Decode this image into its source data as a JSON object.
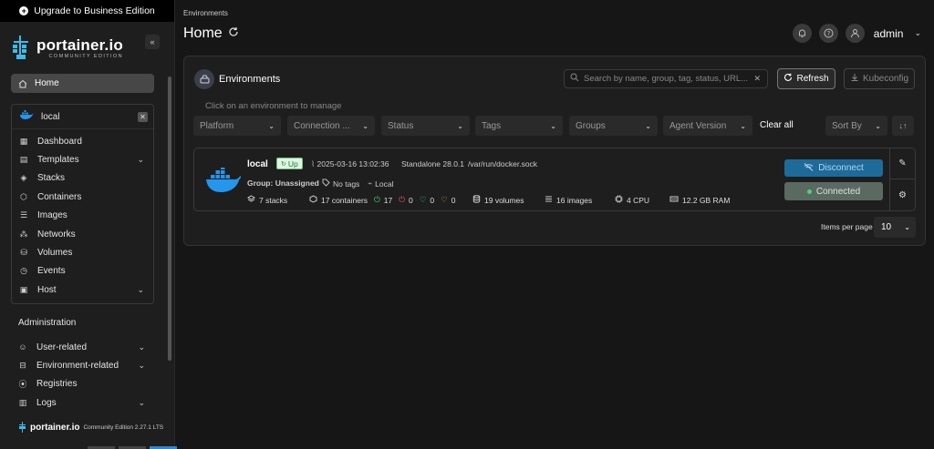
{
  "sidebar": {
    "upgrade_label": "Upgrade to Business Edition",
    "logo_title": "portainer.io",
    "logo_subtitle": "COMMUNITY EDITION",
    "home_label": "Home",
    "environment": {
      "name": "local",
      "items": [
        {
          "label": "Dashboard",
          "icon": "dashboard-icon",
          "chevron": false
        },
        {
          "label": "Templates",
          "icon": "templates-icon",
          "chevron": true
        },
        {
          "label": "Stacks",
          "icon": "stacks-icon",
          "chevron": false
        },
        {
          "label": "Containers",
          "icon": "containers-icon",
          "chevron": false
        },
        {
          "label": "Images",
          "icon": "images-icon",
          "chevron": false
        },
        {
          "label": "Networks",
          "icon": "networks-icon",
          "chevron": false
        },
        {
          "label": "Volumes",
          "icon": "volumes-icon",
          "chevron": false
        },
        {
          "label": "Events",
          "icon": "events-icon",
          "chevron": false
        },
        {
          "label": "Host",
          "icon": "host-icon",
          "chevron": true
        }
      ]
    },
    "admin_heading": "Administration",
    "admin_items": [
      {
        "label": "User-related",
        "icon": "users-icon",
        "chevron": true
      },
      {
        "label": "Environment-related",
        "icon": "environment-icon",
        "chevron": true
      },
      {
        "label": "Registries",
        "icon": "registries-icon",
        "chevron": false
      },
      {
        "label": "Logs",
        "icon": "logs-icon",
        "chevron": true
      }
    ],
    "footer_brand": "portainer.io",
    "footer_edition": "Community Edition 2.27.1 LTS"
  },
  "header": {
    "breadcrumb": "Environments",
    "title": "Home",
    "user": "admin"
  },
  "panel": {
    "title": "Environments",
    "search_placeholder": "Search by name, group, tag, status, URL...",
    "refresh_label": "Refresh",
    "kubeconfig_label": "Kubeconfig",
    "hint": "Click on an environment to manage",
    "filters": {
      "platform": "Platform",
      "connection": "Connection ...",
      "status": "Status",
      "tags": "Tags",
      "groups": "Groups",
      "agent_version": "Agent Version",
      "clear_all": "Clear all",
      "sort_by": "Sort By"
    },
    "environment": {
      "name": "local",
      "status": "Up",
      "timestamp": "2025-03-16 13:02:36",
      "type": "Standalone 28.0.1",
      "socket": "/var/run/docker.sock",
      "group": "Group: Unassigned",
      "tags": "No tags",
      "location": "Local",
      "stacks": "7 stacks",
      "containers": "17 containers",
      "running": "17",
      "stopped": "0",
      "healthy": "0",
      "unhealthy": "0",
      "volumes": "19 volumes",
      "images": "16 images",
      "cpu": "4 CPU",
      "ram": "12.2 GB RAM",
      "disconnect_label": "Disconnect",
      "connected_label": "Connected"
    },
    "items_per_page_label": "Items per page",
    "items_per_page_value": "10"
  },
  "colors": {
    "accent_blue": "#1d6b9b",
    "running_green": "#52d273",
    "stopped_red": "#e35d5d",
    "unhealthy_amber": "#e3a14a",
    "docker_blue": "#2496ed"
  }
}
